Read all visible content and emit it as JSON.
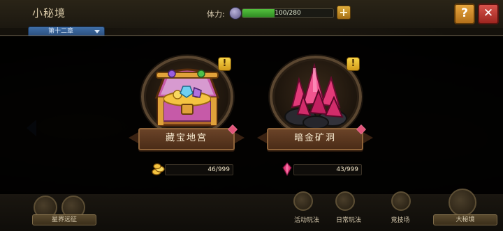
{
  "header": {
    "title": "小秘境",
    "chapter_tab": "第十二章",
    "stamina_label": "体力:",
    "stamina_text": "100/280",
    "stamina_current": 100,
    "stamina_max": 280,
    "plus_label": "+",
    "help_label": "?",
    "close_label": "✕"
  },
  "cards": [
    {
      "name": "藏宝地宫",
      "alert": "!",
      "count": "46/999",
      "icon": "treasure-chest-icon",
      "currency_icon": "gold-coins-icon"
    },
    {
      "name": "暗金矿洞",
      "alert": "!",
      "count": "43/999",
      "icon": "crystal-ore-icon",
      "currency_icon": "pink-crystal-icon"
    }
  ],
  "bottom": {
    "left_button": "星界远征",
    "activity": "活动玩法",
    "daily": "日常玩法",
    "arena": "竞技场",
    "big_realm": "大秘境"
  },
  "colors": {
    "accent_gold": "#d29a1a",
    "close_red": "#b4332b",
    "stamina_green": "#3fa82e",
    "crystal_pink": "#e1557a"
  }
}
